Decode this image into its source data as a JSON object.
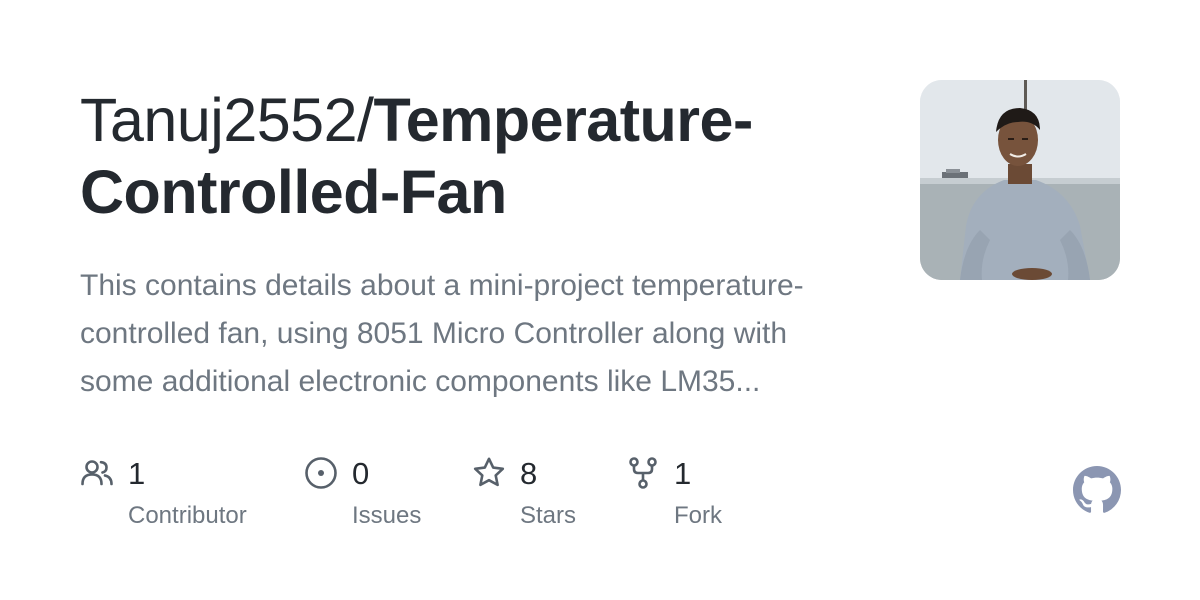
{
  "repo": {
    "owner": "Tanuj2552/",
    "name_line1": "Temperature-",
    "name_line2": "Controlled-Fan",
    "description": "This contains details about a mini-project temperature-controlled fan, using 8051 Micro Controller along with some additional electronic components like LM35..."
  },
  "stats": [
    {
      "icon": "people-icon",
      "count": "1",
      "label": "Contributor"
    },
    {
      "icon": "issue-icon",
      "count": "0",
      "label": "Issues"
    },
    {
      "icon": "star-icon",
      "count": "8",
      "label": "Stars"
    },
    {
      "icon": "fork-icon",
      "count": "1",
      "label": "Fork"
    }
  ],
  "colors": {
    "text": "#24292f",
    "muted": "#6e7781",
    "icon": "#57606a",
    "github_logo": "#8b96b2"
  },
  "icons": {
    "avatar": "owner-avatar",
    "logo": "github-logo-icon"
  }
}
